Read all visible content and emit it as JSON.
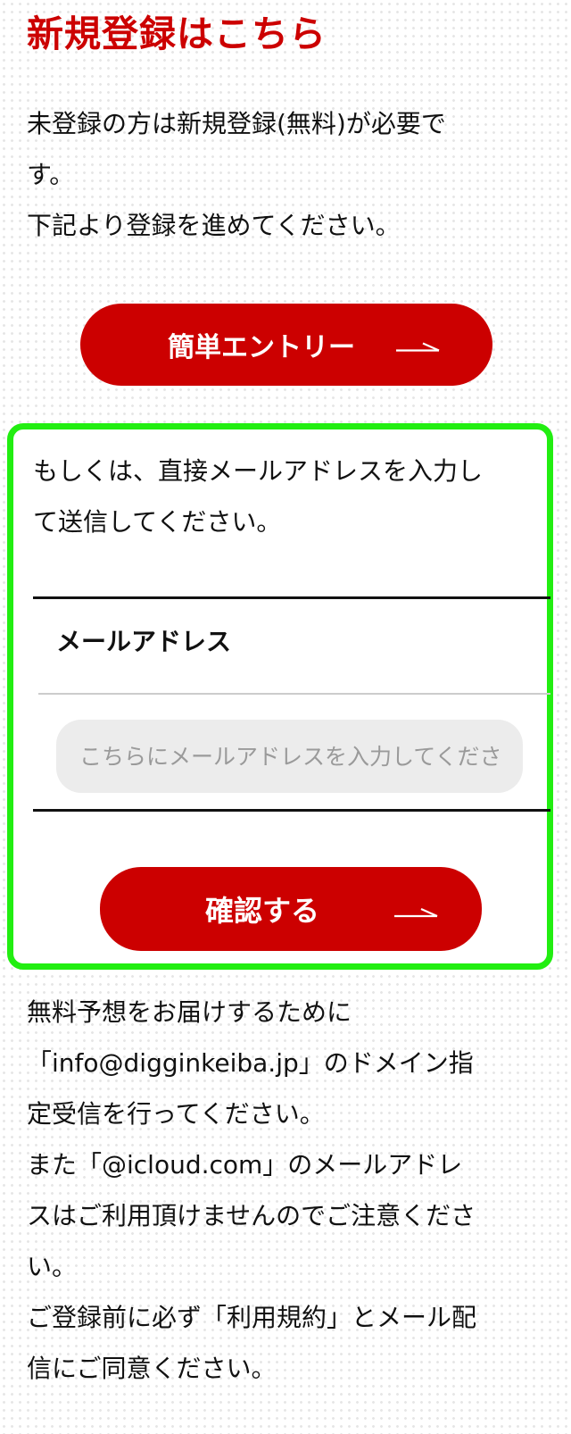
{
  "heading": "新規登録はこちら",
  "intro": {
    "lines": [
      "未登録の方は新規登録(無料)が必要で",
      "す。",
      "下記より登録を進めてください。"
    ]
  },
  "entry_button": {
    "label": "簡単エントリー",
    "icon": "long-arrow-right-icon"
  },
  "form": {
    "text_lines": [
      "もしくは、直接メールアドレスを入力し",
      "て送信してください。"
    ],
    "email_label": "メールアドレス",
    "email_placeholder": "こちらにメールアドレスを入力してください",
    "email_value": "",
    "confirm_label": "確認する",
    "confirm_icon": "long-arrow-right-icon",
    "highlight_color": "#22ee11"
  },
  "notice": {
    "lines": [
      "無料予想をお届けするために",
      "「info@digginkeiba.jp」のドメイン指",
      "定受信を行ってください。",
      "また「@icloud.com」のメールアドレ",
      "スはご利用頂けませんのでご注意くださ",
      "い。",
      "ご登録前に必ず「利用規約」とメール配",
      "信にご同意ください。"
    ]
  },
  "colors": {
    "accent": "#cc0000",
    "text": "#111111",
    "input_bg": "#ececec"
  }
}
